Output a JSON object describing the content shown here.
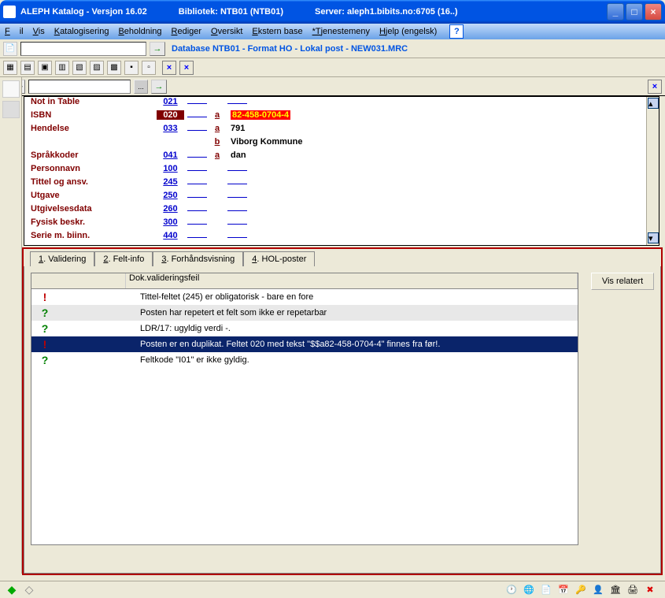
{
  "titlebar": {
    "app": "ALEPH Katalog - Versjon 16.02",
    "lib": "Bibliotek:  NTB01 (NTB01)",
    "server": "Server:  aleph1.bibits.no:6705 (16..)"
  },
  "menu": {
    "fil": "Fil",
    "vis": "Vis",
    "kat": "Katalogisering",
    "beh": "Beholdning",
    "red": "Rediger",
    "ove": "Oversikt",
    "eks": "Ekstern base",
    "tje": "*Tjenestemeny",
    "hje": "Hjelp (engelsk)"
  },
  "database_label": "Database NTB01 - Format HO - Lokal post - NEW031.MRC",
  "marc": [
    {
      "label": "Not in Table",
      "tag": "021",
      "sub": "",
      "val": ""
    },
    {
      "label": "ISBN",
      "tag": "020",
      "sub": "a",
      "val": "82-458-0704-4",
      "hilite": true,
      "selected": true
    },
    {
      "label": "Hendelse",
      "tag": "033",
      "sub": "a",
      "val": "791"
    },
    {
      "label": "",
      "tag": "",
      "sub": "b",
      "val": "Viborg Kommune"
    },
    {
      "label": "Språkkoder",
      "tag": "041",
      "sub": "a",
      "val": "dan"
    },
    {
      "label": "Personnavn",
      "tag": "100",
      "sub": "",
      "val": ""
    },
    {
      "label": "Tittel og ansv.",
      "tag": "245",
      "sub": "",
      "val": ""
    },
    {
      "label": "Utgave",
      "tag": "250",
      "sub": "",
      "val": ""
    },
    {
      "label": "Utgivelsesdata",
      "tag": "260",
      "sub": "",
      "val": ""
    },
    {
      "label": "Fysisk beskr.",
      "tag": "300",
      "sub": "",
      "val": ""
    },
    {
      "label": "Serie m. biinn.",
      "tag": "440",
      "sub": "",
      "val": ""
    }
  ],
  "tabs": {
    "t1": "1. Validering",
    "t2": "2. Felt-info",
    "t3": "3. Forhåndsvisning",
    "t4": "4. HOL-poster"
  },
  "errheader": "Dok.valideringsfeil",
  "errors": [
    {
      "icon": "!",
      "color": "red",
      "text": "Tittel-feltet (245) er obligatorisk - bare en fore"
    },
    {
      "icon": "?",
      "color": "grn",
      "text": "Posten har repetert et felt som ikke er repetarbar",
      "alt": true
    },
    {
      "icon": "?",
      "color": "grn",
      "text": "LDR/17: ugyldig verdi -."
    },
    {
      "icon": "!",
      "color": "red",
      "text": "Posten er en duplikat. Feltet 020 med tekst \"$$a82-458-0704-4\" finnes fra før!.",
      "sel": true
    },
    {
      "icon": "?",
      "color": "grn",
      "text": "Feltkode \"I01\" er ikke gyldig."
    }
  ],
  "visrelatert": "Vis relatert"
}
